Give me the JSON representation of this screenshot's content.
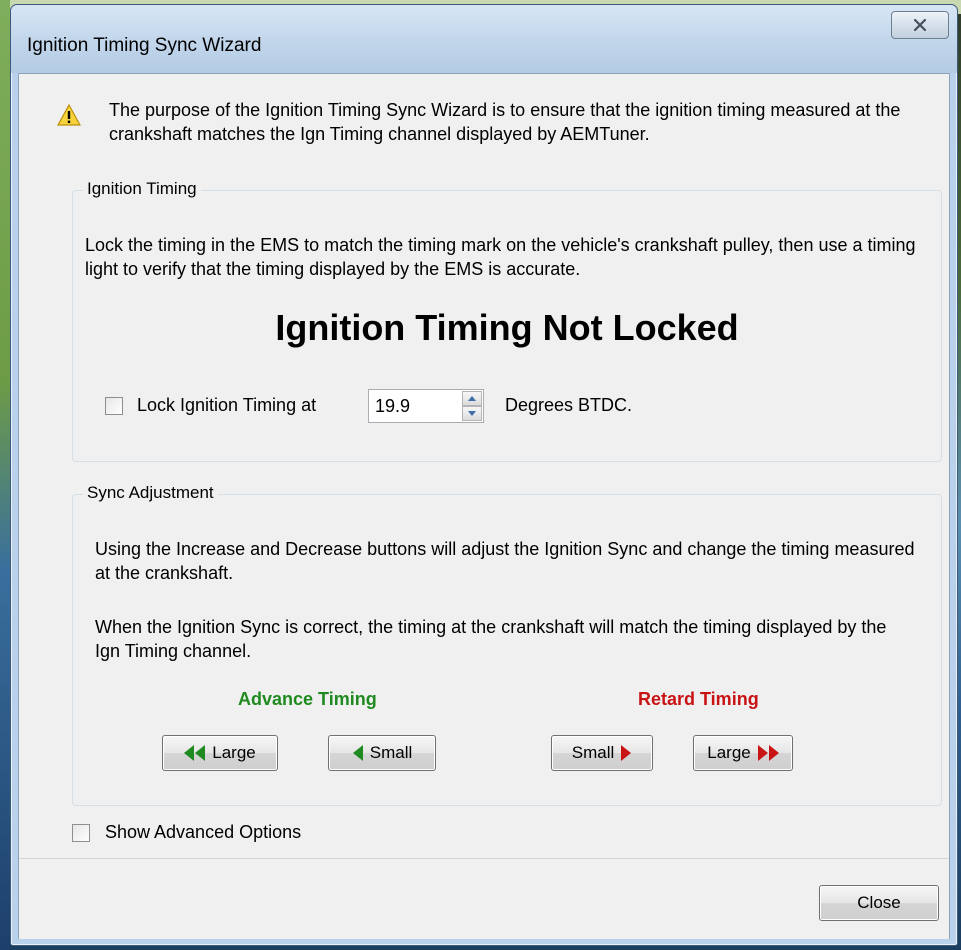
{
  "window": {
    "title": "Ignition Timing Sync Wizard",
    "close_glyph": "✕"
  },
  "info": {
    "icon": "warning-icon",
    "text": "The purpose of the Ignition Timing Sync Wizard is to ensure that the ignition timing measured at the crankshaft matches the Ign Timing channel displayed by AEMTuner."
  },
  "ignition_timing": {
    "group_label": "Ignition Timing",
    "description": "Lock the timing in the EMS to match the timing mark on the vehicle's crankshaft pulley, then use a timing light to verify that the timing displayed by the EMS is accurate.",
    "status": "Ignition Timing Not Locked",
    "lock_checkbox_label": "Lock Ignition Timing at",
    "lock_checked": false,
    "lock_value": "19.9",
    "units_label": "Degrees BTDC."
  },
  "sync_adjustment": {
    "group_label": "Sync Adjustment",
    "description_1": "Using the Increase and Decrease buttons will adjust the Ignition Sync and change the timing measured at the crankshaft.",
    "description_2": "When the Ignition Sync is correct, the timing at the crankshaft will  match the timing displayed by the Ign Timing channel.",
    "advance_header": "Advance Timing",
    "retard_header": "Retard Timing",
    "advance_large_label": "Large",
    "advance_small_label": "Small",
    "retard_small_label": "Small",
    "retard_large_label": "Large",
    "colors": {
      "advance": "#1f8a1f",
      "retard": "#c81414"
    }
  },
  "advanced": {
    "checkbox_label": "Show Advanced Options",
    "checked": false
  },
  "footer": {
    "close_label": "Close"
  }
}
